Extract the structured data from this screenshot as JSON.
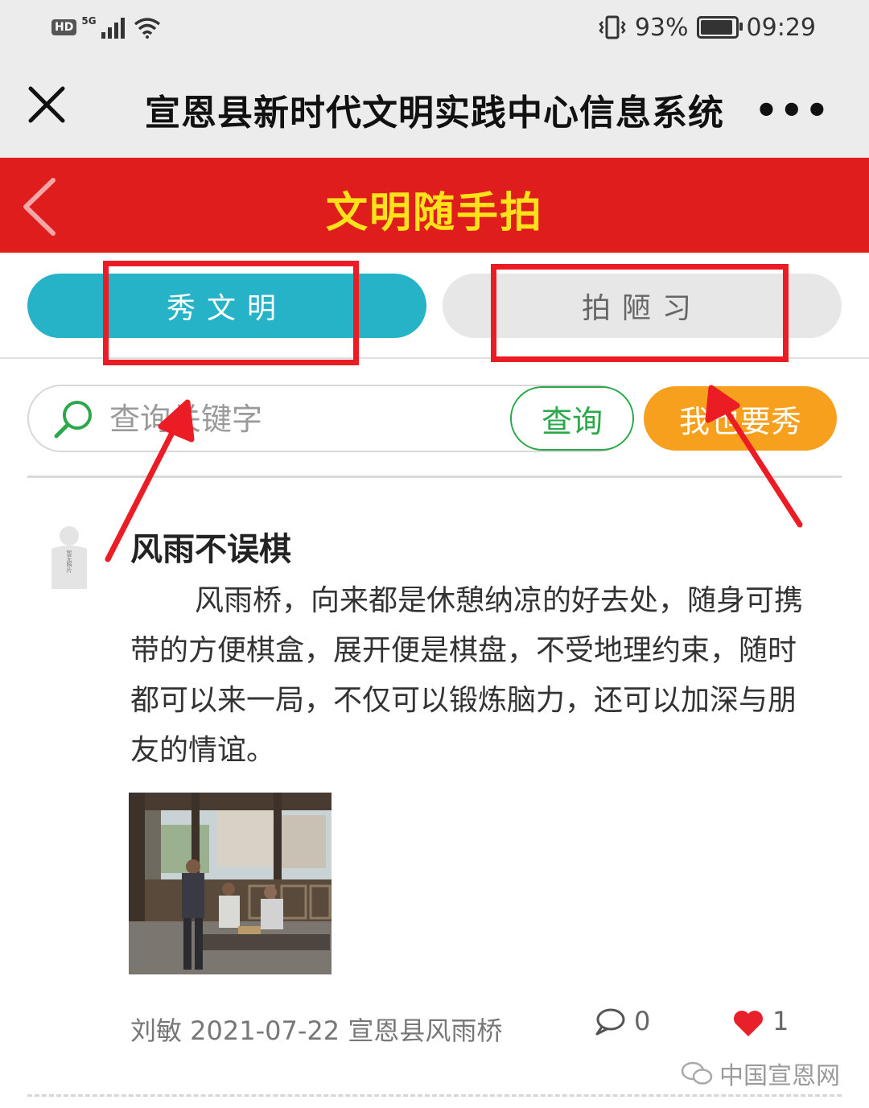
{
  "status_bar": {
    "hd": "HD",
    "network": "5G",
    "battery_percent": "93%",
    "battery_level": 0.93,
    "time": "09:29"
  },
  "wechat_header": {
    "title": "宣恩县新时代文明实践中心信息系统",
    "more": "•••"
  },
  "app_bar": {
    "title": "文明随手拍"
  },
  "tabs": [
    {
      "label": "秀文明",
      "active": true
    },
    {
      "label": "拍陋习",
      "active": false
    }
  ],
  "search": {
    "placeholder": "查询关键字",
    "query_button": "查询",
    "show_button": "我也要秀"
  },
  "post": {
    "avatar_text": "暂无照片",
    "title": "风雨不误棋",
    "body": "风雨桥，向来都是休憩纳凉的好去处，随身可携带的方便棋盒，展开便是棋盘，不受地理约束，随时都可以来一局，不仅可以锻炼脑力，还可以加深与朋友的情谊。",
    "meta": "刘敏 2021-07-22 宣恩县风雨桥",
    "comment_count": "0",
    "like_count": "1"
  },
  "watermark": "中国宣恩网",
  "colors": {
    "red_bar": "#e01d1d",
    "title_yellow": "#ffe21a",
    "tab_active": "#26b3c7",
    "tab_inactive": "#e7e7e7",
    "query_green": "#2aa84a",
    "show_orange": "#f7a01d",
    "annotation_red": "#ec1c24",
    "heart": "#e8202a"
  }
}
